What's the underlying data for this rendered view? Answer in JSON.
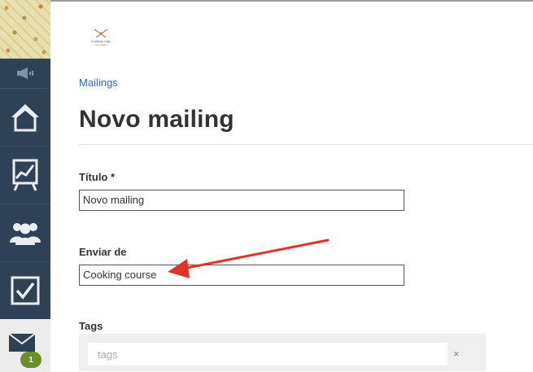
{
  "sidebar": {
    "badge_count": "1",
    "items": [
      {
        "name": "home",
        "icon": "home-icon"
      },
      {
        "name": "reports",
        "icon": "chart-icon"
      },
      {
        "name": "contacts",
        "icon": "people-icon"
      },
      {
        "name": "tasks",
        "icon": "checkbox-icon"
      },
      {
        "name": "mailings",
        "icon": "mail-icon"
      }
    ]
  },
  "logo": {
    "line1": "Cooking Logo",
    "line2": "Your tagline"
  },
  "breadcrumb": "Mailings",
  "page_title": "Novo mailing",
  "form": {
    "title_label": "Título *",
    "title_value": "Novo mailing",
    "from_label": "Enviar de",
    "from_value": "Cooking course",
    "tags_label": "Tags",
    "tags_placeholder": "tags",
    "tags_clear": "×"
  },
  "colors": {
    "sidebar_bg": "#2e4155",
    "link": "#2a6eb5",
    "badge": "#6b8e2c",
    "arrow": "#e0332a"
  }
}
